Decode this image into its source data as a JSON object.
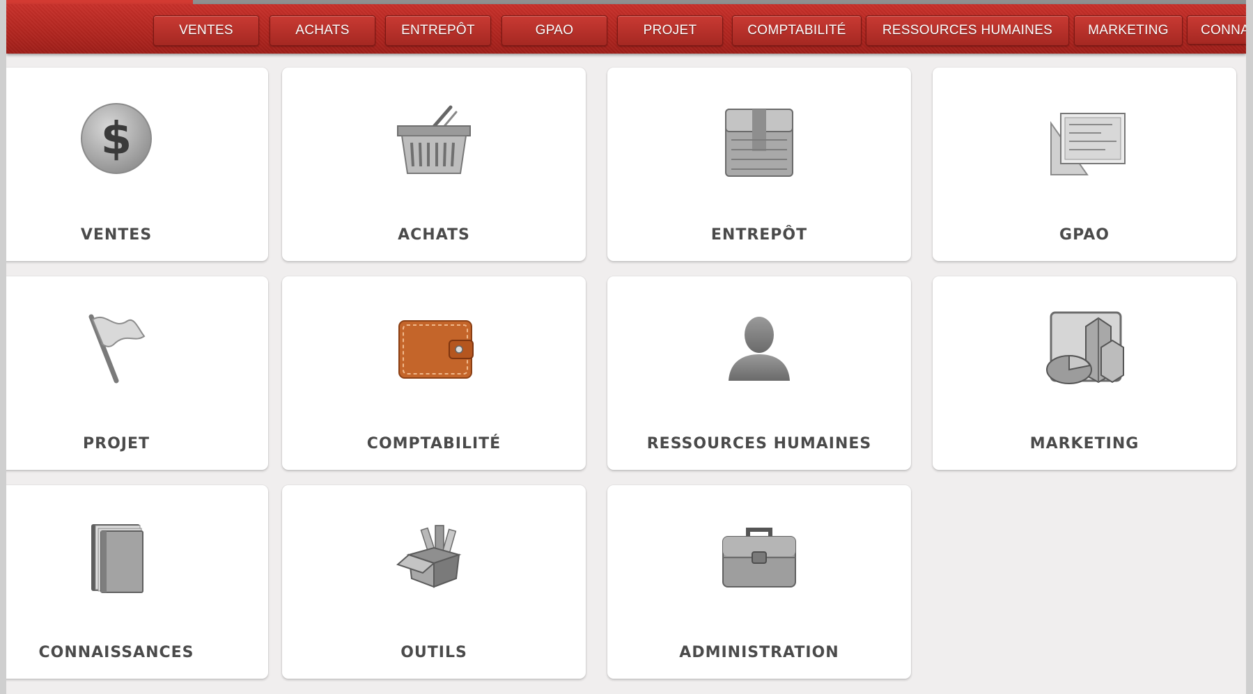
{
  "top_menu": {
    "items": [
      {
        "label": "VENTES"
      },
      {
        "label": "ACHATS"
      },
      {
        "label": "ENTREPÔT"
      },
      {
        "label": "GPAO"
      },
      {
        "label": "PROJET"
      },
      {
        "label": "COMPTABILITÉ"
      },
      {
        "label": "RESSOURCES HUMAINES"
      },
      {
        "label": "MARKETING"
      },
      {
        "label": "CONNAISSANCES"
      }
    ],
    "colors": {
      "bar": "#b32620",
      "button": "#c93a33"
    }
  },
  "tiles": [
    {
      "label": "VENTES",
      "icon": "dollar-coin-icon"
    },
    {
      "label": "ACHATS",
      "icon": "shopping-basket-icon"
    },
    {
      "label": "ENTREPÔT",
      "icon": "storage-crate-icon"
    },
    {
      "label": "GPAO",
      "icon": "blueprint-drafting-icon"
    },
    {
      "label": "PROJET",
      "icon": "flag-icon"
    },
    {
      "label": "COMPTABILITÉ",
      "icon": "wallet-icon"
    },
    {
      "label": "RESSOURCES HUMAINES",
      "icon": "person-icon"
    },
    {
      "label": "MARKETING",
      "icon": "chart-icon"
    },
    {
      "label": "CONNAISSANCES",
      "icon": "books-icon"
    },
    {
      "label": "OUTILS",
      "icon": "tools-box-icon"
    },
    {
      "label": "ADMINISTRATION",
      "icon": "briefcase-icon"
    }
  ]
}
